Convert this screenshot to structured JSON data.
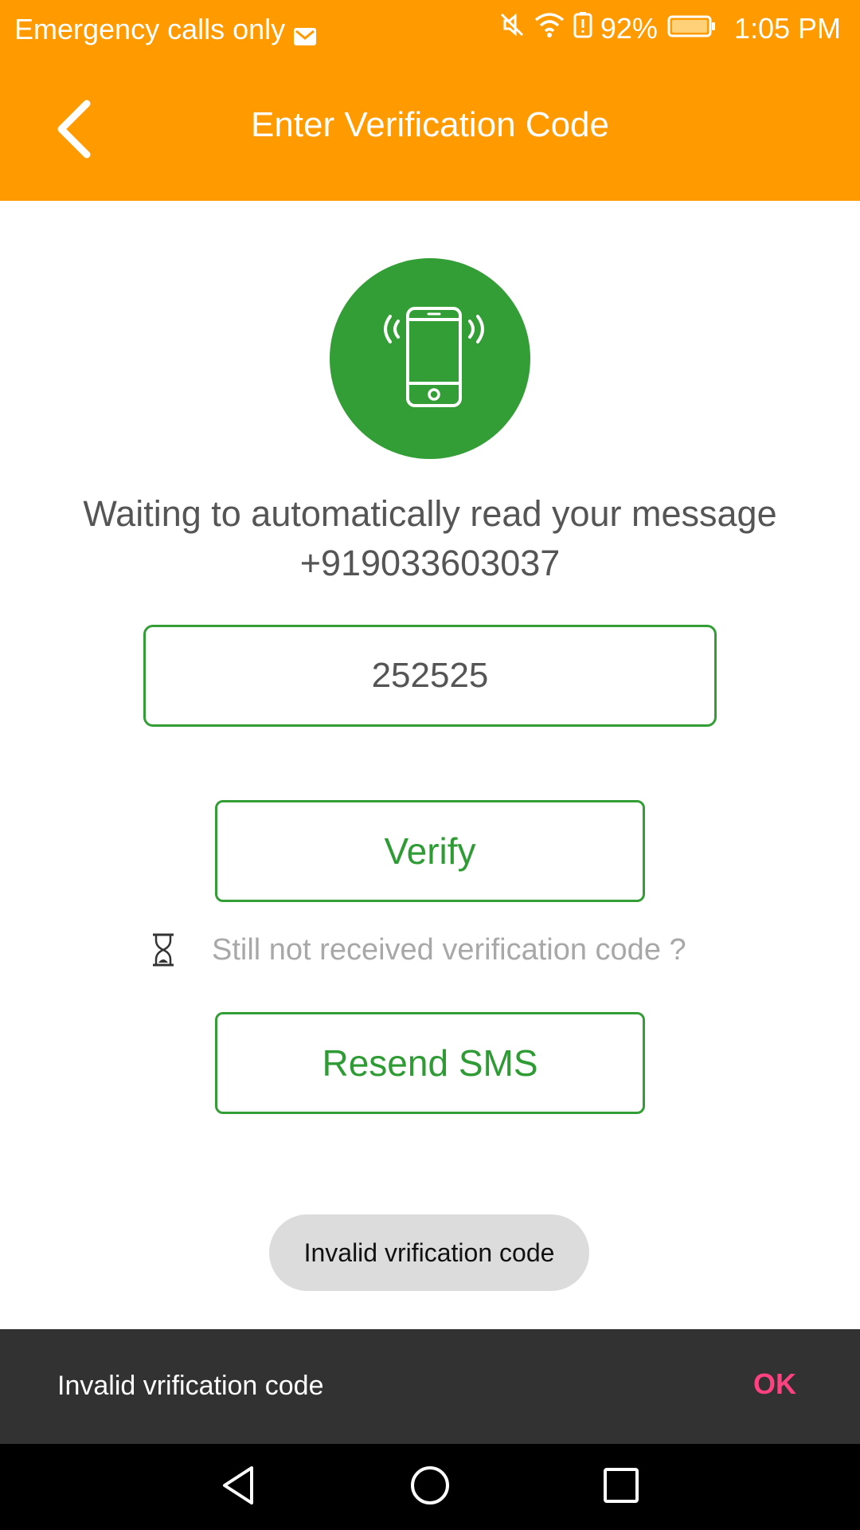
{
  "status_bar": {
    "carrier_text": "Emergency calls only",
    "battery_percent": "92%",
    "time": "1:05 PM",
    "icons": [
      "mail-icon",
      "mute-icon",
      "wifi-icon",
      "battery-alert-icon",
      "battery-icon"
    ]
  },
  "app_bar": {
    "title": "Enter Verification Code",
    "back_icon": "chevron-left-icon"
  },
  "main": {
    "illustration_icon": "phone-vibrate-icon",
    "waiting_line1": "Waiting to automatically read your message",
    "phone_number": "+919033603037",
    "code_value": "252525",
    "verify_label": "Verify",
    "not_received_text": "Still not received verification code ?",
    "not_received_icon": "hourglass-icon",
    "resend_label": "Resend SMS"
  },
  "toast": {
    "message": "Invalid vrification code"
  },
  "snackbar": {
    "message": "Invalid vrification code",
    "action_label": "OK"
  },
  "colors": {
    "accent_orange": "#FF9A00",
    "brand_green": "#339E35",
    "snackbar_action": "#FF4081"
  }
}
